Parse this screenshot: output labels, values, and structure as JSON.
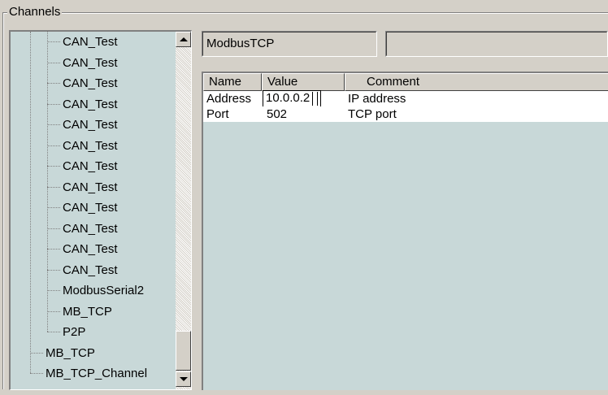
{
  "groupbox": {
    "title": "Channels"
  },
  "tree": {
    "items": [
      {
        "label": "CAN_Test",
        "level": 2
      },
      {
        "label": "CAN_Test",
        "level": 2
      },
      {
        "label": "CAN_Test",
        "level": 2
      },
      {
        "label": "CAN_Test",
        "level": 2
      },
      {
        "label": "CAN_Test",
        "level": 2
      },
      {
        "label": "CAN_Test",
        "level": 2
      },
      {
        "label": "CAN_Test",
        "level": 2
      },
      {
        "label": "CAN_Test",
        "level": 2
      },
      {
        "label": "CAN_Test",
        "level": 2
      },
      {
        "label": "CAN_Test",
        "level": 2
      },
      {
        "label": "CAN_Test",
        "level": 2
      },
      {
        "label": "CAN_Test",
        "level": 2
      },
      {
        "label": "ModbusSerial2",
        "level": 2
      },
      {
        "label": "MB_TCP",
        "level": 2
      },
      {
        "label": "P2P",
        "level": 2
      },
      {
        "label": "MB_TCP",
        "level": 1
      },
      {
        "label": "MB_TCP_Channel",
        "level": 1,
        "selected": true
      }
    ]
  },
  "details": {
    "name_field": "ModbusTCP",
    "second_field": ""
  },
  "grid": {
    "columns": [
      "Name",
      "Value",
      "Comment"
    ],
    "rows": [
      {
        "name": "Address",
        "value": "10.0.0.2",
        "comment": "IP address",
        "editing": true
      },
      {
        "name": "Port",
        "value": "502",
        "comment": "TCP port"
      }
    ]
  },
  "colors": {
    "panel_bg": "#c8d8d8",
    "window_bg": "#d4d0c8",
    "row_bg": "#ffffff"
  }
}
